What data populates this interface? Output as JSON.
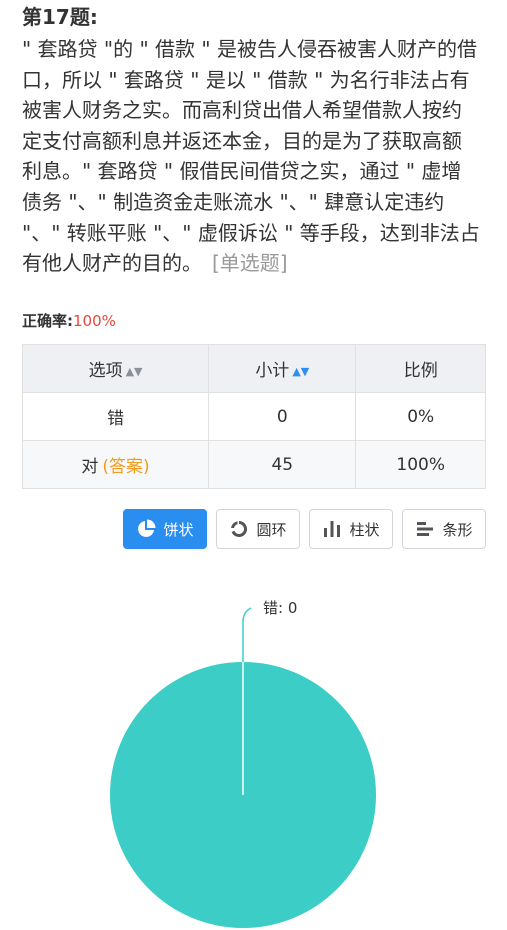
{
  "question": {
    "number_label": "第17题:",
    "lines": [
      "\" 套路贷 \"的 \" 借款 \" 是被告人侵吞被害人财产的借",
      "口，所以 \" 套路贷 \" 是以 \" 借款 \" 为名行非法占有",
      "被害人财务之实。而高利贷出借人希望借款人按约",
      "定支付高额利息并返还本金，目的是为了获取高额",
      "利息。\" 套路贷 \" 假借民间借贷之实，通过 \" 虚增",
      "债务 \"、\" 制造资金走账流水 \"、\" 肆意认定违约",
      "\"、\" 转账平账 \"、\" 虚假诉讼 \" 等手段，达到非法占",
      "有他人财产的目的。"
    ],
    "type_tag": "[单选题]"
  },
  "accuracy": {
    "label": "正确率:",
    "value": "100%"
  },
  "table": {
    "headers": [
      "选项",
      "小计",
      "比例"
    ],
    "rows": [
      {
        "option": "错",
        "answer_tag": "",
        "count": "0",
        "ratio": "0%"
      },
      {
        "option": "对",
        "answer_tag": "(答案)",
        "count": "45",
        "ratio": "100%"
      }
    ]
  },
  "chart_buttons": [
    {
      "label": "饼状",
      "icon": "pie-icon",
      "active": true
    },
    {
      "label": "圆环",
      "icon": "donut-icon",
      "active": false
    },
    {
      "label": "柱状",
      "icon": "bar-chart-icon",
      "active": false
    },
    {
      "label": "条形",
      "icon": "bar-horizontal-icon",
      "active": false
    }
  ],
  "colors": {
    "accent": "#2a8ef0",
    "pie": "#3bcdc6",
    "accuracy": "#e9463e",
    "answer": "#f29b1c"
  },
  "chart_data": {
    "type": "pie",
    "categories": [
      "错",
      "对"
    ],
    "values": [
      0,
      45
    ],
    "labels_shown": [
      "错: 0"
    ]
  }
}
